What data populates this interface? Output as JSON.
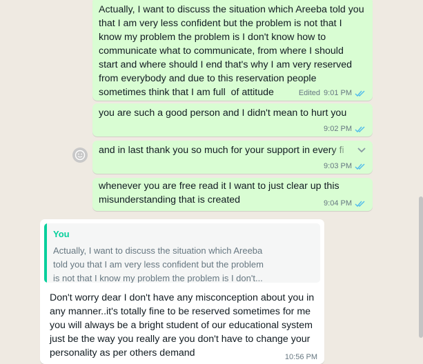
{
  "messages": [
    {
      "text": "Actually, I want to discuss the situation which Areeba told you\nthat I am very less confident but the problem is not that I\nknow my problem the problem is I don't know how to\ncommunicate what to communicate, from where I should\nstart and where should I end that's why I am very reserved\nfrom everybody and due to this reservation people\nsometimes think that I am full  of attitude",
      "edited_label": "Edited",
      "time": "9:01 PM"
    },
    {
      "text": "you are such a good person and I didn't mean to hurt you",
      "time": "9:02 PM"
    },
    {
      "text": "and in last thank you so much for your support in every fi",
      "time": "9:03 PM"
    },
    {
      "text": "whenever you are free read it I want to just clear up this\nmisunderstanding that is created",
      "time": "9:04 PM"
    }
  ],
  "reply": {
    "quote_author": "You",
    "quote_text": "Actually, I want to discuss the situation which Areeba\ntold you that I am very less confident but the problem\nis not that I know my problem the problem is I don't...",
    "text": "Don't worry dear I don't have any misconception about you in\nany manner..it's totally fine to be reserved sometimes for me\nyou will always be a bright student of our educational system\njust be the way you really are you don't have to change your\npersonality as per others demand",
    "time": "10:56 PM"
  },
  "colors": {
    "outgoing_bubble": "#d9fdd3",
    "incoming_bubble": "#ffffff",
    "read_ticks": "#53bdeb",
    "quote_accent": "#06cf9c",
    "chat_background": "#efeae2"
  },
  "icons": {
    "read_receipt": "double-check-icon",
    "reaction": "emoji-smile-icon",
    "menu": "chevron-down-icon"
  }
}
